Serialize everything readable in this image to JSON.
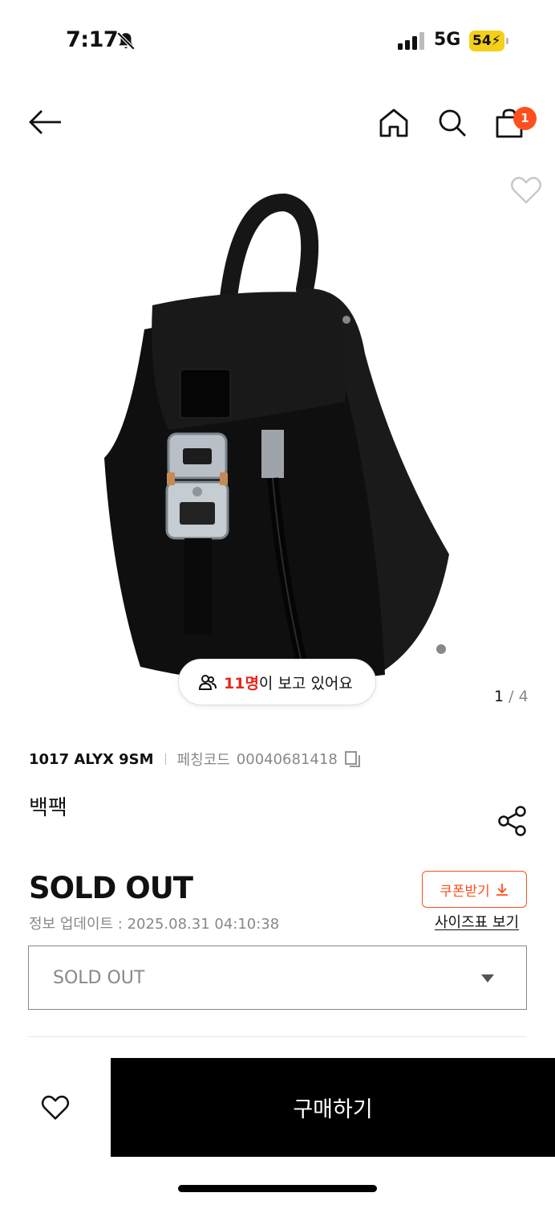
{
  "status_bar": {
    "time": "7:17",
    "network": "5G",
    "battery": "54"
  },
  "header": {
    "cart_count": "1"
  },
  "gallery": {
    "viewer_count": "11명",
    "viewer_suffix": "이 보고 있어요",
    "current_page": "1",
    "separator": "/",
    "total_pages": "4"
  },
  "product": {
    "brand": "1017 ALYX 9SM",
    "code_label": "페칭코드",
    "code_value": "00040681418",
    "name": "백팩",
    "price_status": "SOLD OUT",
    "update_info": "정보 업데이트 : 2025.08.31 04:10:38"
  },
  "actions": {
    "coupon_label": "쿠폰받기",
    "size_chart_label": "사이즈표 보기",
    "option_value": "SOLD OUT",
    "buy_label": "구매하기"
  },
  "colors": {
    "accent": "#ff4f1f",
    "viewer_highlight": "#e8261d",
    "battery": "#f5d019"
  }
}
